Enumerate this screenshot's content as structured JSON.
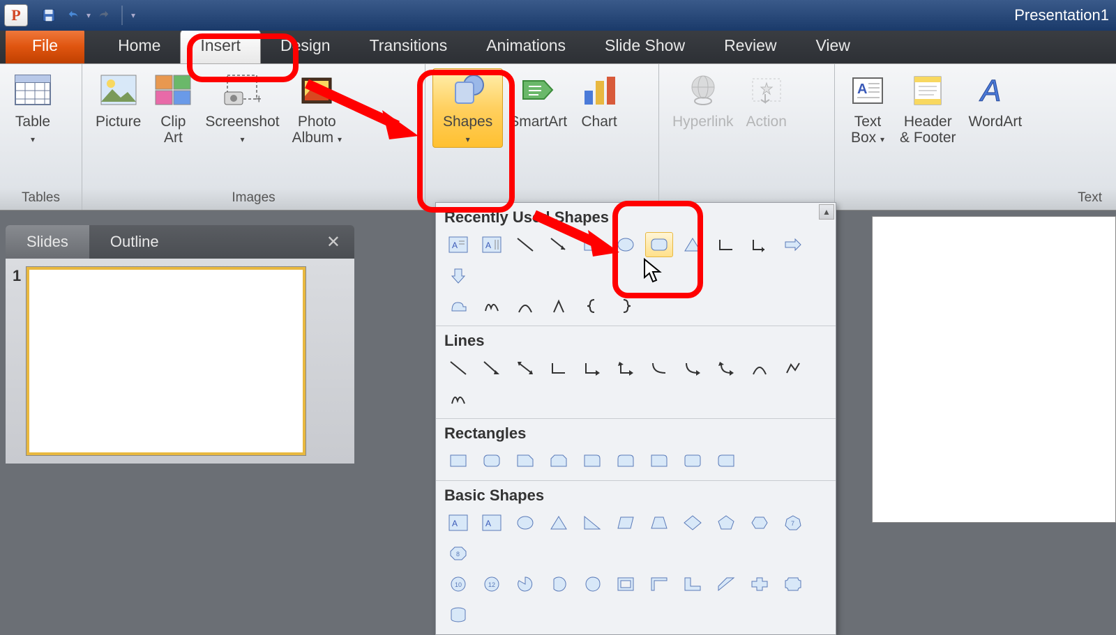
{
  "app": {
    "title": "Presentation1",
    "icon_letter": "P"
  },
  "qat": {
    "save": "save-icon",
    "undo": "undo-icon",
    "redo": "redo-icon"
  },
  "tabs": {
    "file": "File",
    "items": [
      "Home",
      "Insert",
      "Design",
      "Transitions",
      "Animations",
      "Slide Show",
      "Review",
      "View"
    ],
    "active": "Insert"
  },
  "ribbon": {
    "groups": {
      "tables": {
        "label": "Tables",
        "table": "Table"
      },
      "images": {
        "label": "Images",
        "picture": "Picture",
        "clipart": "Clip\nArt",
        "screenshot": "Screenshot",
        "photoalbum": "Photo\nAlbum"
      },
      "illustrations": {
        "label": "",
        "shapes": "Shapes",
        "smartart": "SmartArt",
        "chart": "Chart"
      },
      "links": {
        "label": "",
        "hyperlink": "Hyperlink",
        "action": "Action"
      },
      "text": {
        "label": "Text",
        "textbox": "Text\nBox",
        "headerfooter": "Header\n& Footer",
        "wordart": "WordArt"
      }
    }
  },
  "sidepanel": {
    "tabs": {
      "slides": "Slides",
      "outline": "Outline"
    },
    "slide_num": "1"
  },
  "shapes_dropdown": {
    "sections": {
      "recent": "Recently Used Shapes",
      "lines": "Lines",
      "rects": "Rectangles",
      "basic": "Basic Shapes"
    }
  },
  "colors": {
    "accent": "#f07b3f",
    "annotation": "#ff0000"
  }
}
